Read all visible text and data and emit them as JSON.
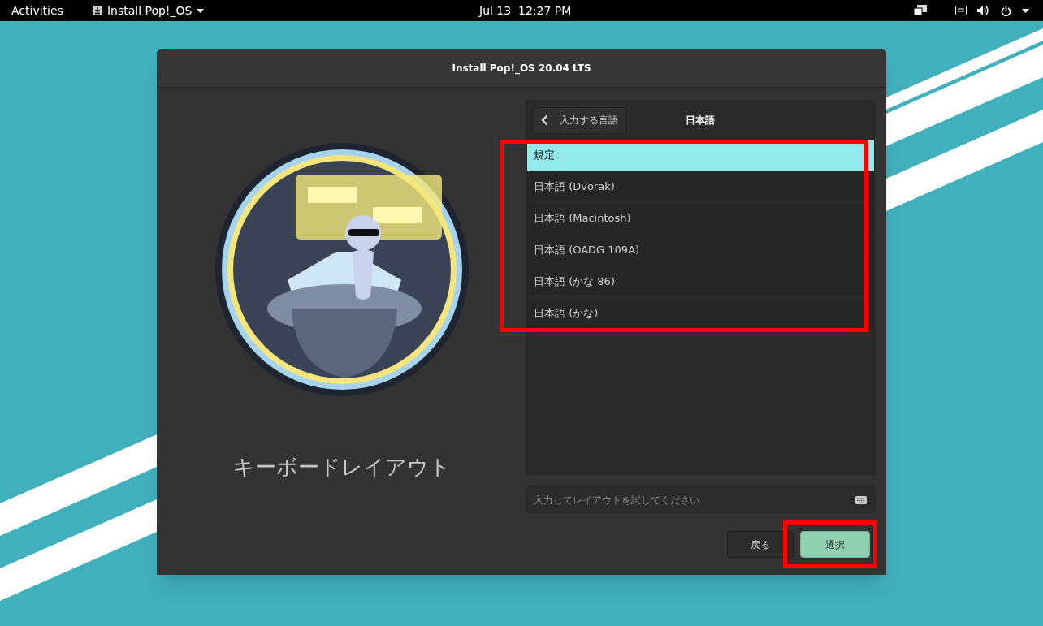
{
  "top_bar": {
    "activities": "Activities",
    "app_menu": "Install Pop!_OS",
    "clock": "Jul 13  12:27 PM"
  },
  "window": {
    "title": "Install Pop!_OS 20.04 LTS"
  },
  "illustration_caption": "キーボードレイアウト",
  "panel": {
    "back_button": "入力する言語",
    "heading": "日本語"
  },
  "layouts": [
    {
      "label": "規定",
      "selected": true
    },
    {
      "label": "日本語 (Dvorak)",
      "selected": false
    },
    {
      "label": "日本語 (Macintosh)",
      "selected": false
    },
    {
      "label": "日本語 (OADG 109A)",
      "selected": false
    },
    {
      "label": "日本語 (かな 86)",
      "selected": false
    },
    {
      "label": "日本語 (かな)",
      "selected": false
    }
  ],
  "test_field": {
    "placeholder": "入力してレイアウトを試してください"
  },
  "buttons": [
    {
      "label": "戻る",
      "kind": "secondary"
    },
    {
      "label": "選択",
      "kind": "primary"
    }
  ]
}
